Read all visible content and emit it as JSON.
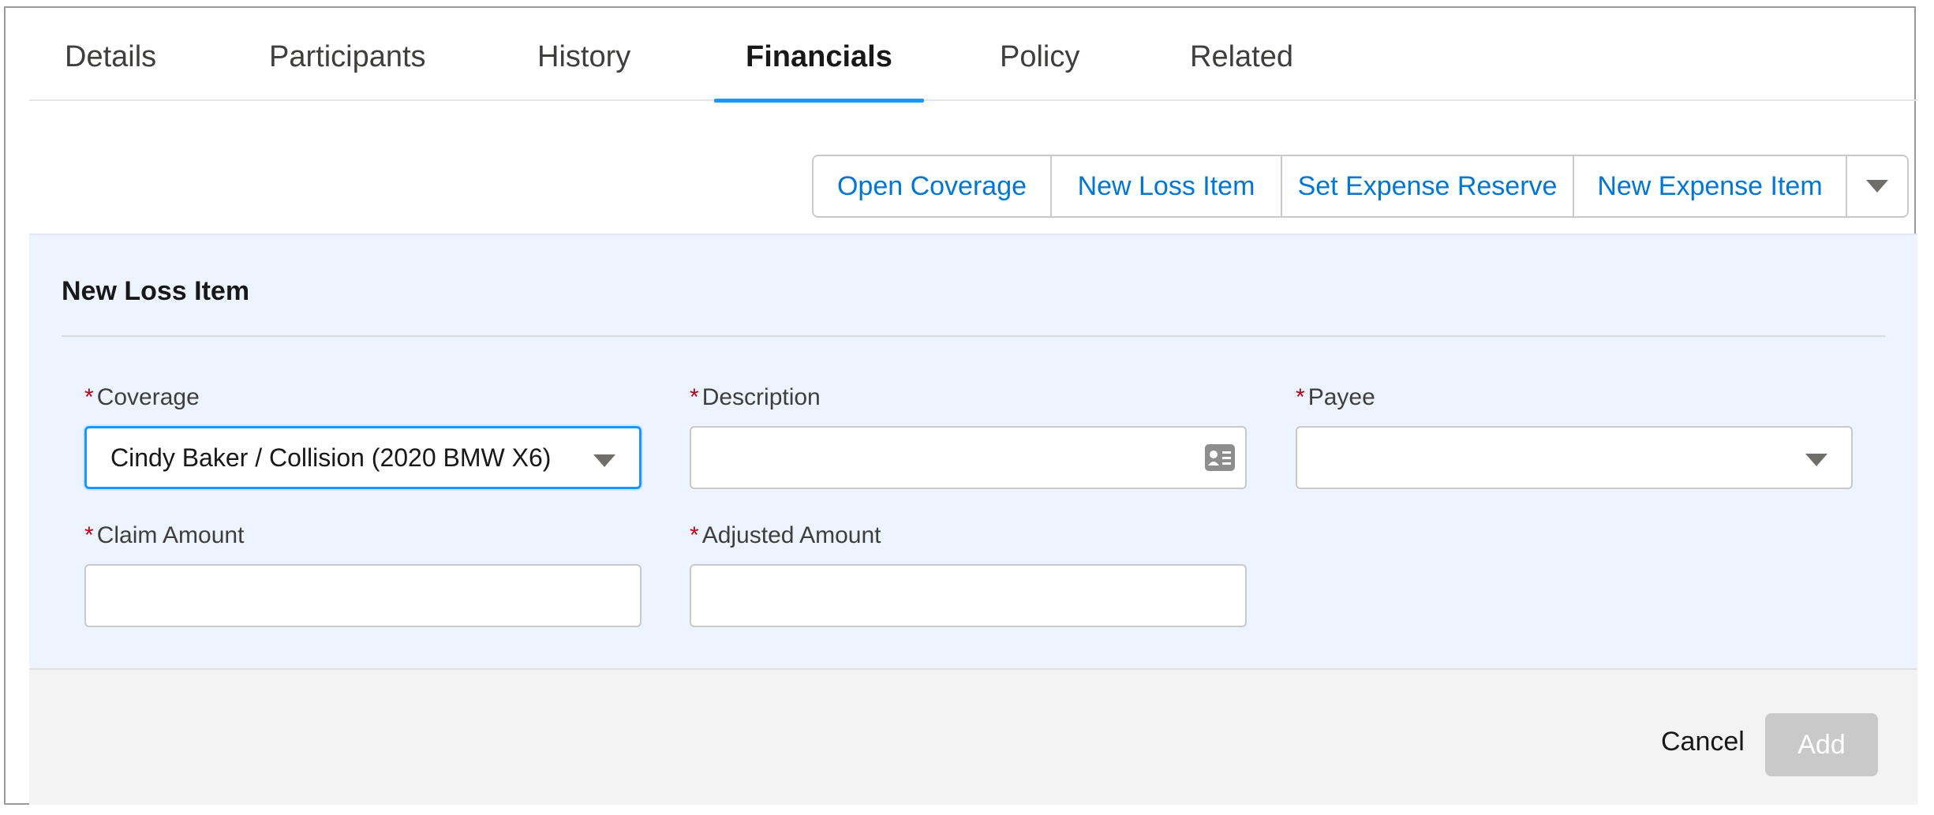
{
  "tabs": [
    {
      "label": "Details"
    },
    {
      "label": "Participants"
    },
    {
      "label": "History"
    },
    {
      "label": "Financials",
      "active": true
    },
    {
      "label": "Policy"
    },
    {
      "label": "Related"
    }
  ],
  "actions": {
    "open_coverage": "Open Coverage",
    "new_loss_item": "New Loss Item",
    "set_expense_reserve": "Set Expense Reserve",
    "new_expense_item": "New Expense Item",
    "more_icon": "chevron-down-icon"
  },
  "form": {
    "title": "New Loss Item",
    "required_marker": "*",
    "fields": {
      "coverage": {
        "label": "Coverage",
        "value": "Cindy Baker / Collision (2020 BMW X6)"
      },
      "description": {
        "label": "Description",
        "value": "",
        "icon": "contact-card-icon"
      },
      "payee": {
        "label": "Payee",
        "value": ""
      },
      "claim_amount": {
        "label": "Claim Amount",
        "value": ""
      },
      "adjusted_amount": {
        "label": "Adjusted Amount",
        "value": ""
      }
    }
  },
  "footer": {
    "cancel_label": "Cancel",
    "add_label": "Add"
  },
  "colors": {
    "accent": "#1b96ff",
    "link": "#0176d3",
    "required": "#ba0517",
    "panel_bg": "#eef4ff",
    "disabled_button": "#c9c9c9"
  }
}
